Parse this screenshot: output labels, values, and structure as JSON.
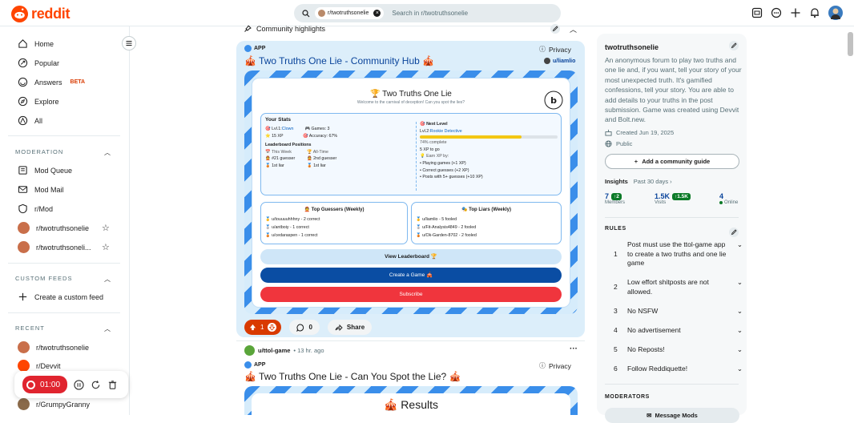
{
  "header": {
    "brand": "reddit",
    "search_chip": "r/twotruthsonelie",
    "search_placeholder": "Search in r/twotruthsonelie",
    "icons": [
      "advertise-icon",
      "chat-icon",
      "create-icon",
      "notifications-icon",
      "avatar"
    ]
  },
  "left_nav": {
    "main": [
      {
        "label": "Home",
        "icon": "home-icon"
      },
      {
        "label": "Popular",
        "icon": "popular-icon"
      },
      {
        "label": "Answers",
        "icon": "answers-icon",
        "badge": "BETA"
      },
      {
        "label": "Explore",
        "icon": "explore-icon"
      },
      {
        "label": "All",
        "icon": "all-icon"
      }
    ],
    "moderation_title": "MODERATION",
    "moderation": [
      {
        "label": "Mod Queue",
        "icon": "mod-queue-icon"
      },
      {
        "label": "Mod Mail",
        "icon": "mod-mail-icon"
      },
      {
        "label": "r/Mod",
        "icon": "mod-icon"
      },
      {
        "label": "r/twotruthsonelie",
        "icon": "community-avatar"
      },
      {
        "label": "r/twotruthsoneli...",
        "icon": "community-avatar"
      }
    ],
    "custom_feeds_title": "CUSTOM FEEDS",
    "create_feed": "Create a custom feed",
    "recent_title": "RECENT",
    "recent": [
      {
        "label": "r/twotruthsonelie"
      },
      {
        "label": "r/Devvit"
      },
      {
        "label": "r/GrumpyGranny"
      }
    ]
  },
  "recorder": {
    "time": "01:00"
  },
  "main": {
    "highlights_label": "Community highlights",
    "post1": {
      "app_tag": "APP",
      "privacy": "Privacy",
      "title": "🎪 Two Truths One Lie - Community Hub 🎪",
      "author": "u/liamlio",
      "game": {
        "title": "🏆 Two Truths One Lie",
        "subtitle": "Welcome to the carnival of deception! Can you spot the lies?",
        "stats_title": "Your Stats",
        "level_label": "🎯 Lvl.1:",
        "level_value": "Clown",
        "games": "🎮 Games: 3",
        "xp": "⭐ 15 XP",
        "accuracy": "🎯 Accuracy: 67%",
        "leaderboard_title": "Leaderboard Positions",
        "this_week": "📅 This Week",
        "all_time": "🏆 All-Time",
        "week_guesser": "👲 #21 guesser",
        "alltime_guesser": "👲 2nd guesser",
        "week_liar": "🥉 1st liar",
        "alltime_liar": "🥉 1st liar",
        "next_level_title": "🎯 Next Level",
        "next_level_label": "Lvl.2:",
        "next_level_value": "Rookie Detective",
        "progress_pct": 74,
        "progress_text": "74% complete",
        "xp_to_go": "5 XP to go",
        "earn_title": "💡 Earn XP by:",
        "earn": [
          "• Playing games (+1 XP)",
          "• Correct guesses (+2 XP)",
          "• Posts with 5+ guesses (+10 XP)"
        ],
        "top_guessers_title": "👲 Top Guessers (Weekly)",
        "top_guessers": [
          "🥇 u/touuuuhhhny - 2 correct",
          "🥈 u/antboiy - 1 correct",
          "🥉 u/cedaraspen - 1 correct"
        ],
        "top_liars_title": "🎭 Top Liars (Weekly)",
        "top_liars": [
          "🥇 u/liamlio - 5 fooled",
          "🥈 u/Fit-Analysis4849 - 2 fooled",
          "🥉 u/Ok-Garden-8702 - 2 fooled"
        ],
        "view_leaderboard": "View Leaderboard 🏆",
        "create_game": "Create a Game 🎪",
        "subscribe": "Subscribe"
      },
      "votes": "1",
      "comments": "0",
      "share": "Share"
    },
    "post2": {
      "author": "u/ttol-game",
      "time": "• 13 hr. ago",
      "app_tag": "APP",
      "privacy": "Privacy",
      "title": "🎪 Two Truths One Lie - Can You Spot the Lie? 🎪",
      "results": "🎪 Results"
    }
  },
  "right": {
    "name": "twotruthsonelie",
    "description": "An anonymous forum to play two truths and one lie and, if you want, tell your story of your most unexpected truth. It's gamified confessions, tell your story. You are able to add details to your truths in the post submission. Game was created using Devvit and Bolt.new.",
    "created": "Created Jun 19, 2025",
    "visibility": "Public",
    "guide_button": "Add a community guide",
    "insights": "Insights",
    "insights_period": "Past 30 days",
    "members": "7",
    "members_delta": "2",
    "members_label": "Members",
    "visits": "1.5K",
    "visits_delta": "1.5K",
    "visits_label": "Visits",
    "online": "4",
    "online_label": "Online",
    "rules_title": "RULES",
    "rules": [
      {
        "n": "1",
        "text": "Post must use the ttol-game app to create a two truths and one lie game"
      },
      {
        "n": "2",
        "text": "Low effort shitposts are not allowed."
      },
      {
        "n": "3",
        "text": "No NSFW"
      },
      {
        "n": "4",
        "text": "No advertisement"
      },
      {
        "n": "5",
        "text": "No Reposts!"
      },
      {
        "n": "6",
        "text": "Follow Reddiquette!"
      }
    ],
    "moderators_title": "MODERATORS",
    "message_mods": "Message Mods"
  },
  "colors": {
    "brand": "#ff4500",
    "accent": "#0a449b",
    "stripe": "#3a8eea",
    "subscribe": "#f0353d",
    "create": "#0a4da3"
  }
}
